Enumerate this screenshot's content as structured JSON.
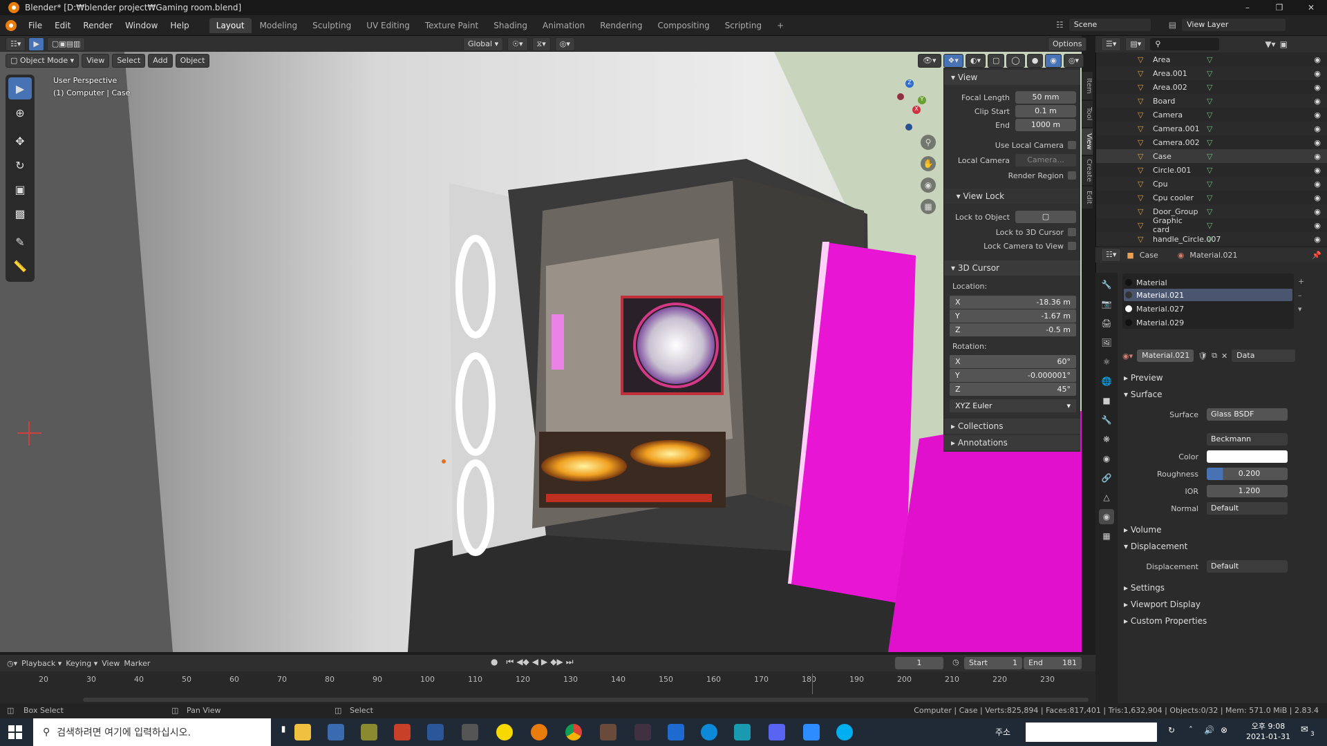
{
  "title": "Blender* [D:₩blender project₩Gaming room.blend]",
  "menu": [
    "File",
    "Edit",
    "Render",
    "Window",
    "Help"
  ],
  "workspaces": [
    "Layout",
    "Modeling",
    "Sculpting",
    "UV Editing",
    "Texture Paint",
    "Shading",
    "Animation",
    "Rendering",
    "Compositing",
    "Scripting"
  ],
  "scene": {
    "scene_label": "Scene",
    "view_layer": "View Layer"
  },
  "viewport_header": {
    "transform": "Global",
    "options": "Options",
    "mode": "Object Mode",
    "menus": [
      "View",
      "Select",
      "Add",
      "Object"
    ]
  },
  "overlay": {
    "perspective": "User Perspective",
    "context": "(1) Computer | Case"
  },
  "npanel": {
    "view_header": "View",
    "focal_length_label": "Focal Length",
    "focal_length": "50 mm",
    "clip_start_label": "Clip Start",
    "clip_start": "0.1 m",
    "end_label": "End",
    "end": "1000 m",
    "use_local_camera": "Use Local Camera",
    "local_camera_label": "Local Camera",
    "local_camera": "Camera...",
    "render_region": "Render Region",
    "view_lock_header": "View Lock",
    "lock_to_object": "Lock to Object",
    "lock_to_3d_cursor": "Lock to 3D Cursor",
    "lock_camera_to_view": "Lock Camera to View",
    "cursor_header": "3D Cursor",
    "location_label": "Location:",
    "loc": [
      {
        "axis": "X",
        "value": "-18.36 m"
      },
      {
        "axis": "Y",
        "value": "-1.67 m"
      },
      {
        "axis": "Z",
        "value": "-0.5 m"
      }
    ],
    "rotation_label": "Rotation:",
    "rot": [
      {
        "axis": "X",
        "value": "60°"
      },
      {
        "axis": "Y",
        "value": "-0.000001°"
      },
      {
        "axis": "Z",
        "value": "45°"
      }
    ],
    "rotation_mode": "XYZ Euler",
    "collections": "Collections",
    "annotations": "Annotations",
    "tabs": [
      "Item",
      "Tool",
      "View",
      "Create",
      "Edit"
    ]
  },
  "outliner": {
    "items": [
      "Area",
      "Area.001",
      "Area.002",
      "Board",
      "Camera",
      "Camera.001",
      "Camera.002",
      "Case",
      "Circle.001",
      "Cpu",
      "Cpu cooler",
      "Door_Group",
      "Graphic card",
      "handle_Circle.007"
    ]
  },
  "properties": {
    "object": "Case",
    "material": "Material.021",
    "slots": [
      "Material",
      "Material.021",
      "Material.027",
      "Material.029"
    ],
    "link": "Data",
    "preview": "Preview",
    "surface_header": "Surface",
    "surface_label": "Surface",
    "surface": "Glass BSDF",
    "distribution": "Beckmann",
    "color_label": "Color",
    "roughness_label": "Roughness",
    "roughness": "0.200",
    "ior_label": "IOR",
    "ior": "1.200",
    "normal_label": "Normal",
    "normal": "Default",
    "volume": "Volume",
    "displacement_header": "Displacement",
    "displacement_label": "Displacement",
    "displacement": "Default",
    "settings": "Settings",
    "viewport_display": "Viewport Display",
    "custom_properties": "Custom Properties"
  },
  "timeline": {
    "menus": [
      "Playback",
      "Keying",
      "View",
      "Marker"
    ],
    "current_frame": "1",
    "start_label": "Start",
    "start": "1",
    "end_label": "End",
    "end": "181",
    "ticks": [
      "20",
      "30",
      "40",
      "50",
      "60",
      "70",
      "80",
      "90",
      "100",
      "110",
      "120",
      "130",
      "140",
      "150",
      "160",
      "170",
      "180",
      "190",
      "200",
      "210",
      "220",
      "230"
    ]
  },
  "status": {
    "box_select": "Box Select",
    "pan_view": "Pan View",
    "select": "Select",
    "stats": "Computer | Case | Verts:825,894 | Faces:817,401 | Tris:1,632,904 | Objects:0/32 | Mem: 571.0 MiB | 2.83.4"
  },
  "taskbar": {
    "search_placeholder": "검색하려면 여기에 입력하십시오.",
    "address_label": "주소",
    "time": "오후 9:08",
    "date": "2021-01-31",
    "notif_count": "3"
  },
  "colors": {
    "accent": "#4772b3",
    "magenta": "#e815d4",
    "logo": "#e87d0d"
  }
}
